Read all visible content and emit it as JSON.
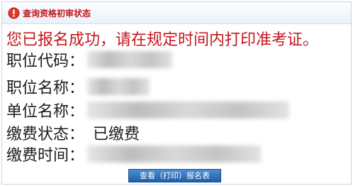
{
  "header": {
    "title": "查询资格初审状态",
    "icon": "alert-icon"
  },
  "notice": "您已报名成功，请在规定时间内打印准考证。",
  "fields": [
    {
      "label": "职位代码：",
      "value": ""
    },
    {
      "label": "职位名称：",
      "value": ""
    },
    {
      "label": "单位名称：",
      "value": ""
    },
    {
      "label": "缴费状态：",
      "value": "已缴费"
    },
    {
      "label": "缴费时间：",
      "value": ""
    }
  ],
  "actions": {
    "print_button": "查看（打印）报名表"
  },
  "colors": {
    "notice": "#c4161c",
    "title": "#c0161b",
    "button": "#2a6db8"
  }
}
